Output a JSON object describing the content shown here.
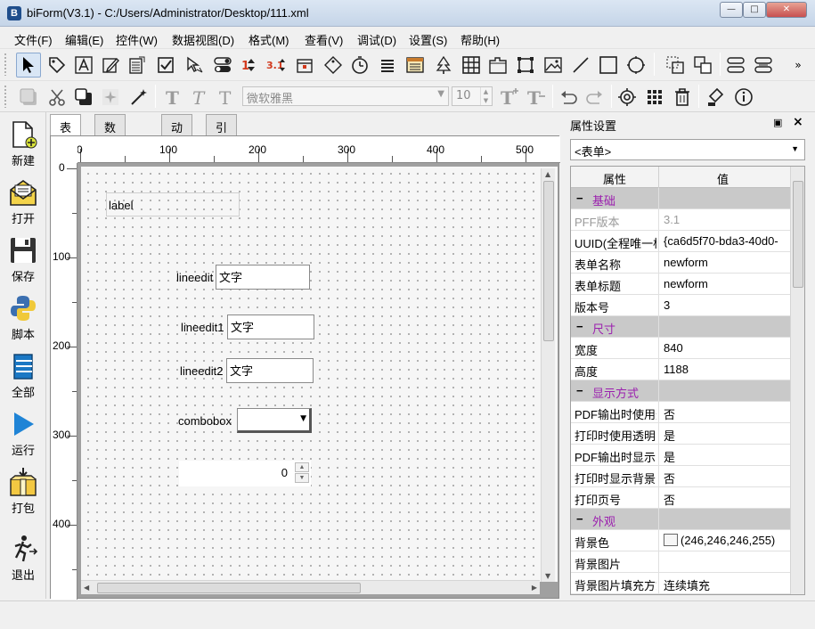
{
  "window": {
    "title": "biForm(V3.1) - C:/Users/Administrator/Desktop/111.xml",
    "app_icon_glyph": "B",
    "min_glyph": "—",
    "max_glyph": "□",
    "close_glyph": "✕"
  },
  "menu": [
    "文件(F)",
    "编辑(E)",
    "控件(W)",
    "数据视图(D)",
    "格式(M)",
    "查看(V)",
    "调试(D)",
    "设置(S)",
    "帮助(H)"
  ],
  "toolbar": {
    "more_glyph": "»",
    "font_name": "微软雅黑",
    "font_size": "10"
  },
  "sidebar": [
    "新建",
    "打开",
    "保存",
    "脚本",
    "全部",
    "运行",
    "打包",
    "退出"
  ],
  "tabs": [
    "表单",
    "数据视图",
    "动作",
    "引用列表"
  ],
  "ruler": {
    "top_labels": [
      "0",
      "100",
      "200",
      "300",
      "400",
      "500"
    ],
    "left_labels": [
      "0",
      "100",
      "200",
      "300",
      "400"
    ]
  },
  "form": {
    "label_text": "label",
    "lineedit_label": "lineedit",
    "lineedit_value": "文字",
    "lineedit1_label": "lineedit1",
    "lineedit1_value": "文字",
    "lineedit2_label": "lineedit2",
    "lineedit2_value": "文字",
    "combobox_label": "combobox",
    "spin_value": "0"
  },
  "properties": {
    "panel_title": "属性设置",
    "selected_object": "<表单>",
    "col_property": "属性",
    "col_value": "值",
    "rows": [
      {
        "type": "group",
        "name": "基础"
      },
      {
        "type": "row",
        "key": "PFF版本",
        "value": "3.1",
        "disabled": true
      },
      {
        "type": "row",
        "key": "UUID(全程唯一标",
        "value": "{ca6d5f70-bda3-40d0-"
      },
      {
        "type": "row",
        "key": "表单名称",
        "value": "newform"
      },
      {
        "type": "row",
        "key": "表单标题",
        "value": "newform"
      },
      {
        "type": "row",
        "key": "版本号",
        "value": "3"
      },
      {
        "type": "group",
        "name": "尺寸"
      },
      {
        "type": "row",
        "key": "宽度",
        "value": "840"
      },
      {
        "type": "row",
        "key": "高度",
        "value": "1188"
      },
      {
        "type": "group",
        "name": "显示方式"
      },
      {
        "type": "row",
        "key": "PDF输出时使用透",
        "value": "否"
      },
      {
        "type": "row",
        "key": "打印时使用透明",
        "value": "是"
      },
      {
        "type": "row",
        "key": "PDF输出时显示",
        "value": "是"
      },
      {
        "type": "row",
        "key": "打印时显示背景",
        "value": "否"
      },
      {
        "type": "row",
        "key": "打印页号",
        "value": "否"
      },
      {
        "type": "group",
        "name": "外观"
      },
      {
        "type": "row",
        "key": "背景色",
        "value": "(246,246,246,255)",
        "color": "#f6f6f6"
      },
      {
        "type": "row",
        "key": "背景图片",
        "value": ""
      },
      {
        "type": "row",
        "key": "背景图片填充方式",
        "value": "连续填充"
      }
    ]
  },
  "colors": {
    "group_row_bg": "#c9c9c9",
    "group_text": "#9b1fae",
    "canvas_bg": "#f6f6f6"
  }
}
